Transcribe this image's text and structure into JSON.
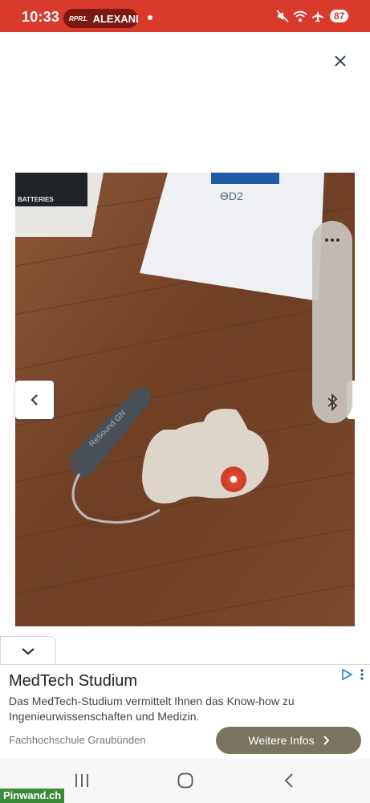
{
  "status_bar": {
    "time": "10:33",
    "notification_logo": "RPR1.",
    "notification_text": "ALEXANDER",
    "battery": "87"
  },
  "viewer": {
    "close_icon": "close-icon",
    "prev_icon": "chevron-left-icon",
    "photo_labels": {
      "batteries": "BATTERIES",
      "package_code": "ϴD2",
      "device_brand": "ReSound GN"
    }
  },
  "side_panel": {
    "more_icon": "more-dots-icon",
    "bluetooth_icon": "bluetooth-icon"
  },
  "ad": {
    "collapse_icon": "chevron-down-icon",
    "title": "MedTech Studium",
    "description": "Das MedTech-Studium vermittelt Ihnen das Know-how zu Ingenieurwissenschaften und Medizin.",
    "source": "Fachhochschule Graubünden",
    "cta_label": "Weitere Infos",
    "cta_color": "#7a7560"
  },
  "nav_bar": {
    "recents_icon": "recent-apps-icon",
    "home_icon": "home-icon",
    "back_icon": "back-icon"
  },
  "watermark": "Pinwand.ch",
  "colors": {
    "status_bar": "#d93a2b",
    "wood": "#7a4a2c"
  }
}
